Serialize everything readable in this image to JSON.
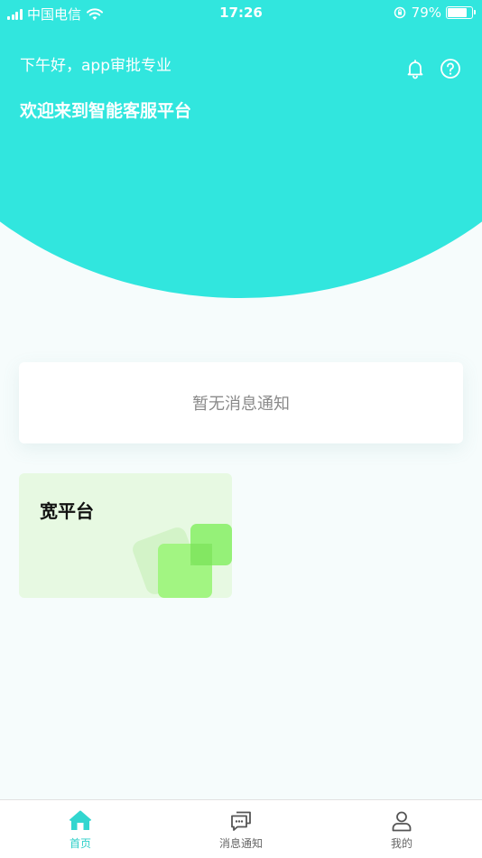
{
  "status_bar": {
    "carrier": "中国电信",
    "time": "17:26",
    "battery": "79%",
    "battery_level": 0.79
  },
  "header": {
    "greeting": "下午好，app审批专业",
    "welcome": "欢迎来到智能客服平台",
    "icons": [
      "bell-icon",
      "help-icon"
    ]
  },
  "notice": {
    "empty_text": "暂无消息通知"
  },
  "platform": {
    "title": "宽平台"
  },
  "tabs": [
    {
      "label": "首页",
      "icon": "home-icon",
      "active": true
    },
    {
      "label": "消息通知",
      "icon": "message-icon",
      "active": false
    },
    {
      "label": "我的",
      "icon": "user-icon",
      "active": false
    }
  ],
  "colors": {
    "brand": "#31e6de",
    "active_tab": "#2ecfc8",
    "tile_bg": "#e7f9e2",
    "tile_accent": "#8ef06f"
  }
}
